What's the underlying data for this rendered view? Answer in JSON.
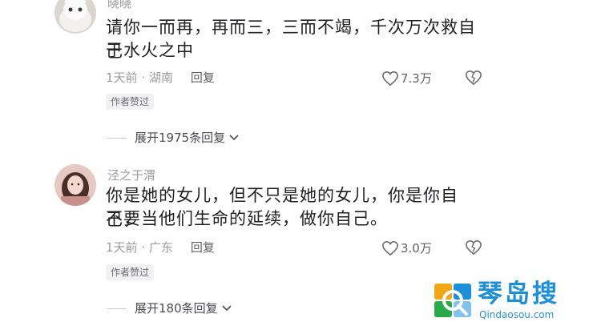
{
  "comments": [
    {
      "username": "晓晓",
      "text_line1": "请你一而再，再而三，三而不竭，千次万次救自己",
      "text_line2": "于水火之中",
      "time_location": "1天前 · 湖南",
      "reply_label": "回复",
      "likes": "7.3万",
      "badge": "作者赞过",
      "expand_label": "展开1975条回复"
    },
    {
      "username": "泾之于渭",
      "text_line1": "你是她的女儿，但不只是她的女儿，你是你自己，",
      "text_line2": "不要当他们生命的延续，做你自己。",
      "time_location": "1天前 · 广东",
      "reply_label": "回复",
      "likes": "3.0万",
      "badge": "作者赞过",
      "expand_label": "展开180条回复"
    }
  ],
  "watermark": {
    "title": "琴岛搜",
    "url": "Qindaosou.com"
  },
  "colors": {
    "text": "#1f1f24",
    "meta": "#9a9ba0",
    "watermark_blue": "#1d8fd8"
  },
  "icons": [
    "heart-icon",
    "broken-heart-icon",
    "chevron-down-icon"
  ]
}
